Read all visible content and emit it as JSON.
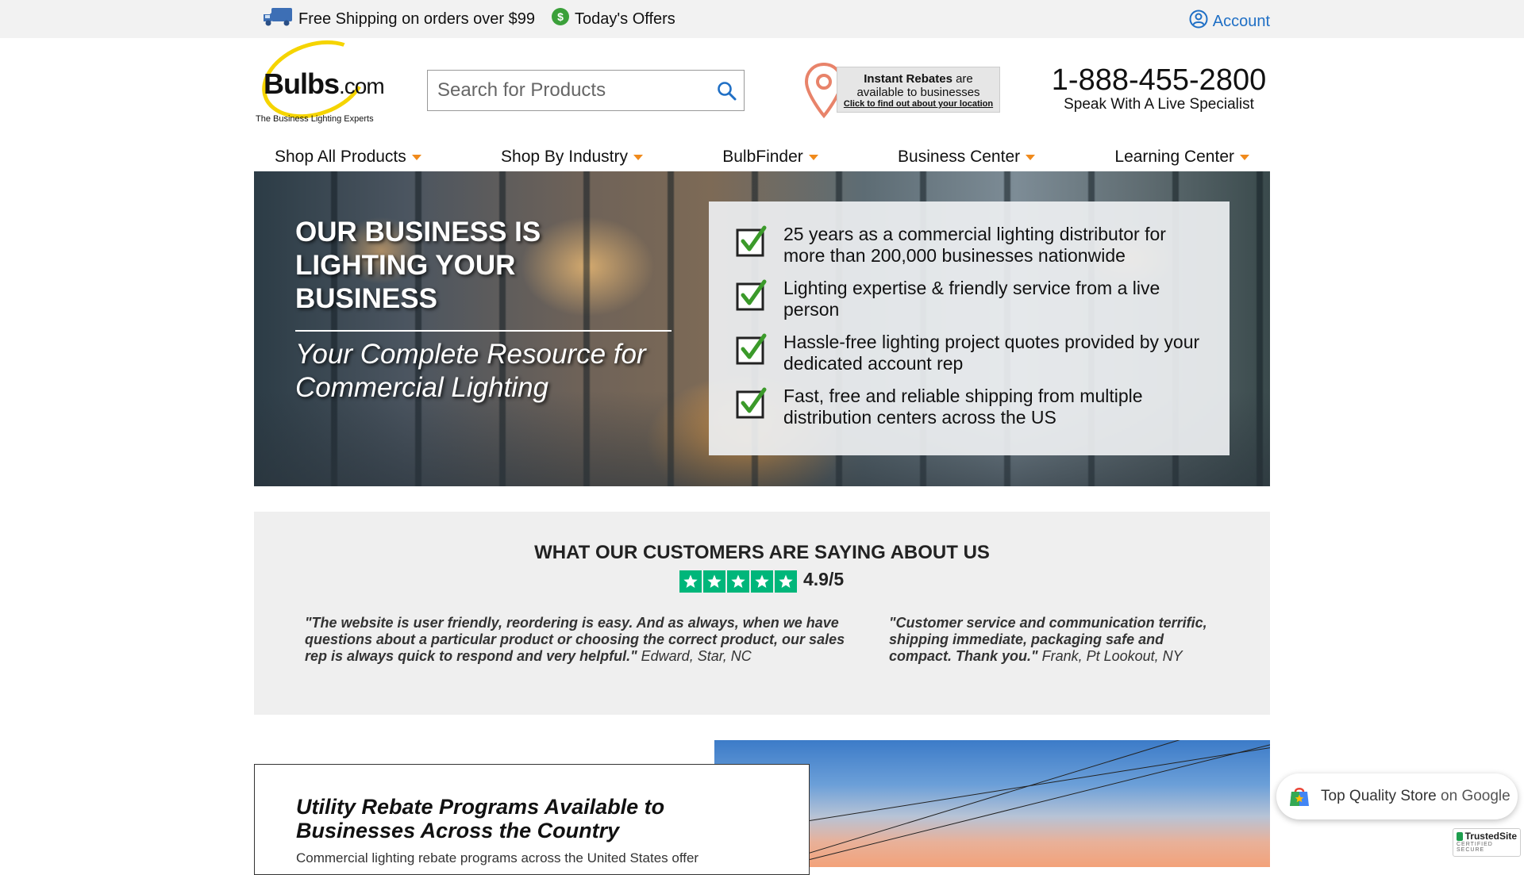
{
  "topbar": {
    "shipping": "Free Shipping on orders over $99",
    "offers": "Today's Offers",
    "account": "Account"
  },
  "header": {
    "logo_text": "Bulbs",
    "logo_suffix": ".com",
    "logo_tagline": "The Business Lighting Experts",
    "search_placeholder": "Search for Products",
    "rebate": {
      "bold": "Instant Rebates",
      "line1_rest": " are",
      "line2": "available to businesses",
      "link": "Click to find out about your location"
    },
    "phone": "1-888-455-2800",
    "phone_sub": "Speak With A Live Specialist"
  },
  "nav": {
    "items": [
      {
        "label": "Shop All Products"
      },
      {
        "label": "Shop By Industry"
      },
      {
        "label": "BulbFinder"
      },
      {
        "label": "Business Center"
      },
      {
        "label": "Learning Center"
      }
    ]
  },
  "hero": {
    "title": "OUR BUSINESS IS LIGHTING YOUR BUSINESS",
    "subtitle": "Your Complete Resource for Commercial Lighting",
    "points": [
      "25 years as a commercial lighting distributor for more than 200,000 businesses nationwide",
      "Lighting expertise & friendly service from a live person",
      "Hassle-free lighting project quotes provided by your dedicated account rep",
      "Fast, free and reliable shipping from multiple distribution centers across the US"
    ]
  },
  "reviews": {
    "title": "WHAT OUR CUSTOMERS ARE SAYING ABOUT US",
    "rating": "4.9/5",
    "stars": 5,
    "quotes": [
      {
        "text": "\"The website is user friendly, reordering is easy. And as always, when we have questions about a particular product or choosing the correct product, our sales rep is always quick to respond and very helpful.\"",
        "author": " Edward, Star, NC"
      },
      {
        "text": "\"Customer service and communication terrific, shipping immediate, packaging safe and compact. Thank you.\"",
        "author": " Frank, Pt Lookout, NY"
      }
    ]
  },
  "programs": {
    "title": "Utility Rebate Programs Available to Businesses Across the Country",
    "text": "Commercial lighting rebate programs across the United States offer"
  },
  "badges": {
    "google_main": "Top Quality Store",
    "google_suffix": " on Google",
    "trusted_name": "TrustedSite",
    "trusted_sub": "CERTIFIED SECURE"
  },
  "colors": {
    "accent_orange": "#f08a1c",
    "account_blue": "#1f6fc5",
    "check_green": "#3b9a2a",
    "trustpilot_green": "#00b67a",
    "logo_yellow": "#f5d400"
  }
}
